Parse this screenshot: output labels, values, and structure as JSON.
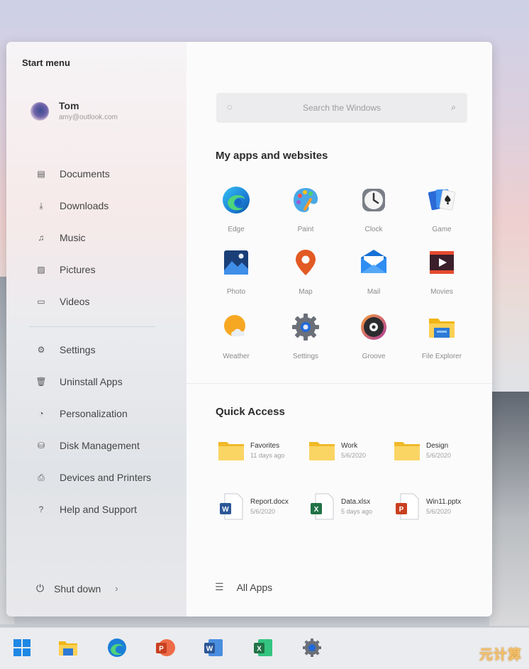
{
  "start_menu": {
    "title": "Start menu",
    "expand_icon": "expand-arrows-icon",
    "user": {
      "name": "Tom",
      "email": "amy@outlook.com"
    },
    "left_nav": [
      {
        "label": "Documents",
        "icon": "document-icon"
      },
      {
        "label": "Downloads",
        "icon": "download-icon"
      },
      {
        "label": "Music",
        "icon": "music-icon"
      },
      {
        "label": "Pictures",
        "icon": "pictures-icon"
      },
      {
        "label": "Videos",
        "icon": "video-icon"
      }
    ],
    "settings_nav": [
      {
        "label": "Settings",
        "icon": "gear-icon"
      },
      {
        "label": "Uninstall Apps",
        "icon": "trash-icon"
      },
      {
        "label": "Personalization",
        "icon": "palette-icon"
      },
      {
        "label": "Disk Management",
        "icon": "disk-icon"
      },
      {
        "label": "Devices and Printers",
        "icon": "printer-icon"
      },
      {
        "label": "Help and Support",
        "icon": "help-icon"
      }
    ],
    "shutdown": {
      "label": "Shut down",
      "icon": "power-icon"
    },
    "search": {
      "placeholder": "Search the Windows"
    },
    "apps_heading": "My apps and websites",
    "apps": [
      {
        "label": "Edge",
        "icon": "edge-icon"
      },
      {
        "label": "Paint",
        "icon": "paint-icon"
      },
      {
        "label": "Clock",
        "icon": "clock-icon"
      },
      {
        "label": "Game",
        "icon": "cards-icon"
      },
      {
        "label": "Photo",
        "icon": "photo-icon"
      },
      {
        "label": "Map",
        "icon": "map-pin-icon"
      },
      {
        "label": "Mail",
        "icon": "mail-icon"
      },
      {
        "label": "Movies",
        "icon": "movies-icon"
      },
      {
        "label": "Weather",
        "icon": "weather-icon"
      },
      {
        "label": "Settings",
        "icon": "settings-gear-icon"
      },
      {
        "label": "Groove",
        "icon": "groove-icon"
      },
      {
        "label": "File Explorer",
        "icon": "file-explorer-icon"
      }
    ],
    "quick_access_heading": "Quick Access",
    "quick_access": [
      {
        "name": "Favorites",
        "sub": "11 days ago",
        "kind": "folder"
      },
      {
        "name": "Work",
        "sub": "5/6/2020",
        "kind": "folder"
      },
      {
        "name": "Design",
        "sub": "5/6/2020",
        "kind": "folder"
      },
      {
        "name": "Report.docx",
        "sub": "5/6/2020",
        "kind": "word"
      },
      {
        "name": "Data.xlsx",
        "sub": "5 days ago",
        "kind": "excel"
      },
      {
        "name": "Win11.pptx",
        "sub": "5/6/2020",
        "kind": "powerpoint"
      }
    ],
    "all_apps_label": "All Apps"
  },
  "taskbar": [
    {
      "icon": "windows-logo-icon"
    },
    {
      "icon": "file-explorer-icon"
    },
    {
      "icon": "edge-icon"
    },
    {
      "icon": "powerpoint-icon"
    },
    {
      "icon": "word-icon"
    },
    {
      "icon": "excel-icon"
    },
    {
      "icon": "settings-gear-icon"
    }
  ],
  "watermark": "元计算",
  "colors": {
    "accent": "#0067c0",
    "folder": "#f7c948",
    "word": "#2b5797",
    "excel": "#217346",
    "powerpoint": "#c8401f"
  }
}
